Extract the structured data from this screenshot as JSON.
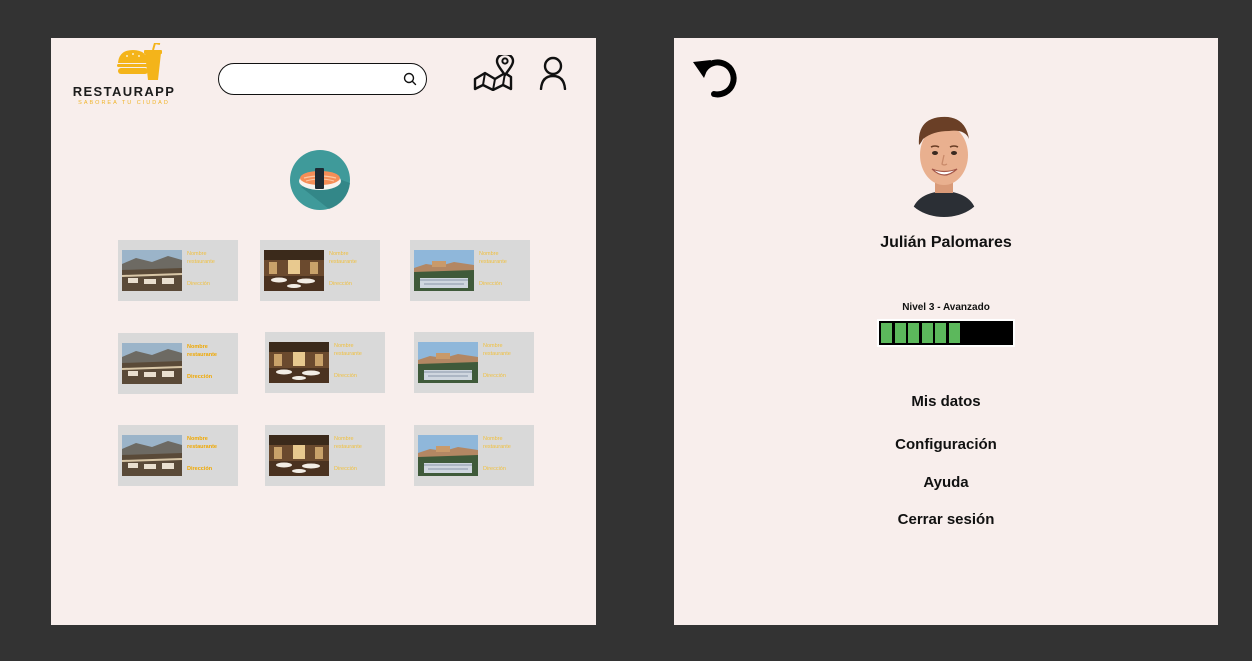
{
  "home": {
    "logo": {
      "title": "RESTAURAPP",
      "tagline": "SABOREA TU CIUDAD"
    },
    "search": {
      "value": "",
      "placeholder": ""
    },
    "category_icon": "sushi-icon",
    "restaurants": [
      {
        "name": "Nombre restaurante",
        "address": "Dirección",
        "image": "mountain-terrace",
        "highlighted": false
      },
      {
        "name": "Nombre restaurante",
        "address": "Dirección",
        "image": "dining-room",
        "highlighted": false
      },
      {
        "name": "Nombre restaurante",
        "address": "Dirección",
        "image": "alhambra-view",
        "highlighted": false
      },
      {
        "name": "Nombre restaurante",
        "address": "Dirección",
        "image": "mountain-terrace",
        "highlighted": true
      },
      {
        "name": "Nombre restaurante",
        "address": "Dirección",
        "image": "dining-room",
        "highlighted": false
      },
      {
        "name": "Nombre restaurante",
        "address": "Dirección",
        "image": "alhambra-view",
        "highlighted": false
      },
      {
        "name": "Nombre restaurante",
        "address": "Dirección",
        "image": "mountain-terrace",
        "highlighted": true
      },
      {
        "name": "Nombre restaurante",
        "address": "Dirección",
        "image": "dining-room",
        "highlighted": false
      },
      {
        "name": "Nombre restaurante",
        "address": "Dirección",
        "image": "alhambra-view",
        "highlighted": false
      }
    ]
  },
  "profile": {
    "name": "Julián Palomares",
    "level_label": "Nivel 3 - Avanzado",
    "progress": {
      "filled_segments": 6,
      "total_segments": 10
    },
    "menu": [
      "Mis datos",
      "Configuración",
      "Ayuda",
      "Cerrar sesión"
    ]
  },
  "colors": {
    "background": "#333333",
    "panel": "#f8eeec",
    "card": "#d9d9d9",
    "accent": "#f0b429",
    "progress_fill": "#5cb85c",
    "sushi_circle": "#3f9a9a"
  }
}
